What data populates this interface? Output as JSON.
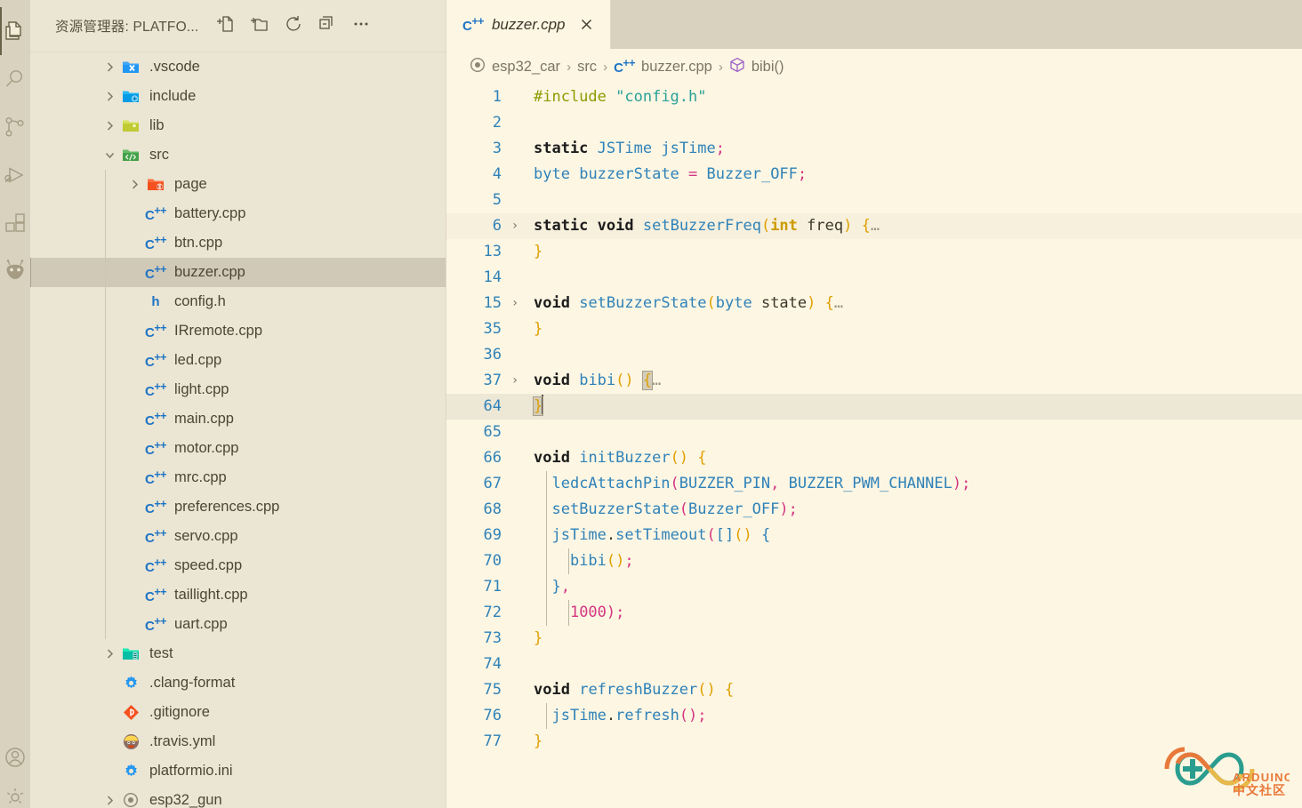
{
  "activity_bar": {
    "items": [
      {
        "name": "explorer",
        "icon": "files-icon",
        "active": true
      },
      {
        "name": "search",
        "icon": "search-icon",
        "active": false
      },
      {
        "name": "source-control",
        "icon": "source-control-icon",
        "active": false
      },
      {
        "name": "run-and-debug",
        "icon": "run-debug-icon",
        "active": false
      },
      {
        "name": "extensions",
        "icon": "extensions-icon",
        "active": false
      },
      {
        "name": "platformio",
        "icon": "platformio-alien-icon",
        "active": false
      }
    ],
    "bottom_items": [
      {
        "name": "accounts",
        "icon": "account-icon"
      },
      {
        "name": "manage-settings",
        "icon": "gear-icon"
      }
    ]
  },
  "sidebar": {
    "title": "资源管理器: PLATFO...",
    "actions": [
      {
        "label": "新建文件",
        "icon": "new-file-icon"
      },
      {
        "label": "新建文件夹",
        "icon": "new-folder-icon"
      },
      {
        "label": "刷新",
        "icon": "refresh-icon"
      },
      {
        "label": "全部折叠",
        "icon": "collapse-all-icon"
      },
      {
        "label": "更多操作",
        "icon": "more-actions-icon"
      }
    ],
    "tree": [
      {
        "label": ".vscode",
        "kind": "folder",
        "icon": "folder-vscode-icon",
        "depth": 0,
        "expanded": false,
        "selected": false
      },
      {
        "label": "include",
        "kind": "folder",
        "icon": "folder-include-icon",
        "depth": 0,
        "expanded": false,
        "selected": false
      },
      {
        "label": "lib",
        "kind": "folder",
        "icon": "folder-lib-icon",
        "depth": 0,
        "expanded": false,
        "selected": false
      },
      {
        "label": "src",
        "kind": "folder",
        "icon": "folder-src-icon",
        "depth": 0,
        "expanded": true,
        "selected": false
      },
      {
        "label": "page",
        "kind": "folder",
        "icon": "folder-page-icon",
        "depth": 1,
        "expanded": false,
        "selected": false
      },
      {
        "label": "battery.cpp",
        "kind": "file",
        "icon": "cpp-file-icon",
        "depth": 1,
        "selected": false
      },
      {
        "label": "btn.cpp",
        "kind": "file",
        "icon": "cpp-file-icon",
        "depth": 1,
        "selected": false
      },
      {
        "label": "buzzer.cpp",
        "kind": "file",
        "icon": "cpp-file-icon",
        "depth": 1,
        "selected": true
      },
      {
        "label": "config.h",
        "kind": "file",
        "icon": "h-file-icon",
        "depth": 1,
        "selected": false
      },
      {
        "label": "IRremote.cpp",
        "kind": "file",
        "icon": "cpp-file-icon",
        "depth": 1,
        "selected": false
      },
      {
        "label": "led.cpp",
        "kind": "file",
        "icon": "cpp-file-icon",
        "depth": 1,
        "selected": false
      },
      {
        "label": "light.cpp",
        "kind": "file",
        "icon": "cpp-file-icon",
        "depth": 1,
        "selected": false
      },
      {
        "label": "main.cpp",
        "kind": "file",
        "icon": "cpp-file-icon",
        "depth": 1,
        "selected": false
      },
      {
        "label": "motor.cpp",
        "kind": "file",
        "icon": "cpp-file-icon",
        "depth": 1,
        "selected": false
      },
      {
        "label": "mrc.cpp",
        "kind": "file",
        "icon": "cpp-file-icon",
        "depth": 1,
        "selected": false
      },
      {
        "label": "preferences.cpp",
        "kind": "file",
        "icon": "cpp-file-icon",
        "depth": 1,
        "selected": false
      },
      {
        "label": "servo.cpp",
        "kind": "file",
        "icon": "cpp-file-icon",
        "depth": 1,
        "selected": false
      },
      {
        "label": "speed.cpp",
        "kind": "file",
        "icon": "cpp-file-icon",
        "depth": 1,
        "selected": false
      },
      {
        "label": "taillight.cpp",
        "kind": "file",
        "icon": "cpp-file-icon",
        "depth": 1,
        "selected": false
      },
      {
        "label": "uart.cpp",
        "kind": "file",
        "icon": "cpp-file-icon",
        "depth": 1,
        "selected": false
      },
      {
        "label": "test",
        "kind": "folder",
        "icon": "folder-test-icon",
        "depth": 0,
        "expanded": false,
        "selected": false
      },
      {
        "label": ".clang-format",
        "kind": "file",
        "icon": "gear-file-icon",
        "depth": 0,
        "selected": false
      },
      {
        "label": ".gitignore",
        "kind": "file",
        "icon": "git-file-icon",
        "depth": 0,
        "selected": false
      },
      {
        "label": ".travis.yml",
        "kind": "file",
        "icon": "travis-file-icon",
        "depth": 0,
        "selected": false
      },
      {
        "label": "platformio.ini",
        "kind": "file",
        "icon": "gear-file-icon",
        "depth": 0,
        "selected": false
      },
      {
        "label": "esp32_gun",
        "kind": "folder",
        "icon": "target-icon",
        "depth": 0,
        "expanded": false,
        "selected": false,
        "partial": true
      }
    ]
  },
  "editor": {
    "tab": {
      "label": "buzzer.cpp",
      "icon": "cpp-file-icon",
      "close_icon": "close-icon"
    },
    "breadcrumb": [
      {
        "label": "esp32_car",
        "icon": "target-icon"
      },
      {
        "label": "src",
        "icon": null
      },
      {
        "label": "buzzer.cpp",
        "icon": "cpp-file-icon"
      },
      {
        "label": "bibi()",
        "icon": "symbol-method-icon"
      }
    ],
    "lines": [
      {
        "n": "1",
        "fold": "",
        "hl": "none"
      },
      {
        "n": "2",
        "fold": "",
        "hl": "none"
      },
      {
        "n": "3",
        "fold": "",
        "hl": "none"
      },
      {
        "n": "4",
        "fold": "",
        "hl": "none"
      },
      {
        "n": "5",
        "fold": "",
        "hl": "none"
      },
      {
        "n": "6",
        "fold": "›",
        "hl": "folded"
      },
      {
        "n": "13",
        "fold": "",
        "hl": "none"
      },
      {
        "n": "14",
        "fold": "",
        "hl": "none"
      },
      {
        "n": "15",
        "fold": "›",
        "hl": "none"
      },
      {
        "n": "35",
        "fold": "",
        "hl": "none"
      },
      {
        "n": "36",
        "fold": "",
        "hl": "none"
      },
      {
        "n": "37",
        "fold": "›",
        "hl": "none"
      },
      {
        "n": "64",
        "fold": "",
        "hl": "current"
      },
      {
        "n": "65",
        "fold": "",
        "hl": "none"
      },
      {
        "n": "66",
        "fold": "",
        "hl": "none"
      },
      {
        "n": "67",
        "fold": "",
        "hl": "none"
      },
      {
        "n": "68",
        "fold": "",
        "hl": "none"
      },
      {
        "n": "69",
        "fold": "",
        "hl": "none"
      },
      {
        "n": "70",
        "fold": "",
        "hl": "none"
      },
      {
        "n": "71",
        "fold": "",
        "hl": "none"
      },
      {
        "n": "72",
        "fold": "",
        "hl": "none"
      },
      {
        "n": "73",
        "fold": "",
        "hl": "none"
      },
      {
        "n": "74",
        "fold": "",
        "hl": "none"
      },
      {
        "n": "75",
        "fold": "",
        "hl": "none"
      },
      {
        "n": "76",
        "fold": "",
        "hl": "none"
      },
      {
        "n": "77",
        "fold": "",
        "hl": "none"
      }
    ],
    "source_text": [
      "#include \"config.h\"",
      "",
      "static JSTime jsTime;",
      "byte buzzerState = Buzzer_OFF;",
      "",
      "static void setBuzzerFreq(int freq) {…",
      "}",
      "",
      "void setBuzzerState(byte state) {…",
      "}",
      "",
      "void bibi() {…",
      "}",
      "",
      "void initBuzzer() {",
      "  ledcAttachPin(BUZZER_PIN, BUZZER_PWM_CHANNEL);",
      "  setBuzzerState(Buzzer_OFF);",
      "  jsTime.setTimeout([]() {",
      "    bibi();",
      "  },",
      "    1000);",
      "}",
      "",
      "void refreshBuzzer() {",
      "  jsTime.refresh();",
      "}"
    ]
  },
  "watermark": {
    "brand": "ARDUINO",
    "community": "中文社区",
    "icon": "arduino-infinity-logo"
  },
  "colors": {
    "editor_bg": "#fdf6e3",
    "sidebar_bg": "#ebe5d3",
    "activitybar_bg": "#d8d2bf",
    "tabbar_bg": "#d8d2bf",
    "selected_row": "#d0c9b7",
    "current_line": "#ede7d6",
    "line_number": "#2f82b8",
    "keyword": "#1c1c1c",
    "function": "#2f82b8",
    "string": "#2aa198",
    "preprocessor": "#8f9a00",
    "number": "#d33682",
    "punct_magenta": "#d33682",
    "paren_yellow": "#dfa000",
    "type_yellow": "#cb9a00",
    "accent_orange": "#e8793a",
    "accent_teal": "#2a9d8f"
  }
}
